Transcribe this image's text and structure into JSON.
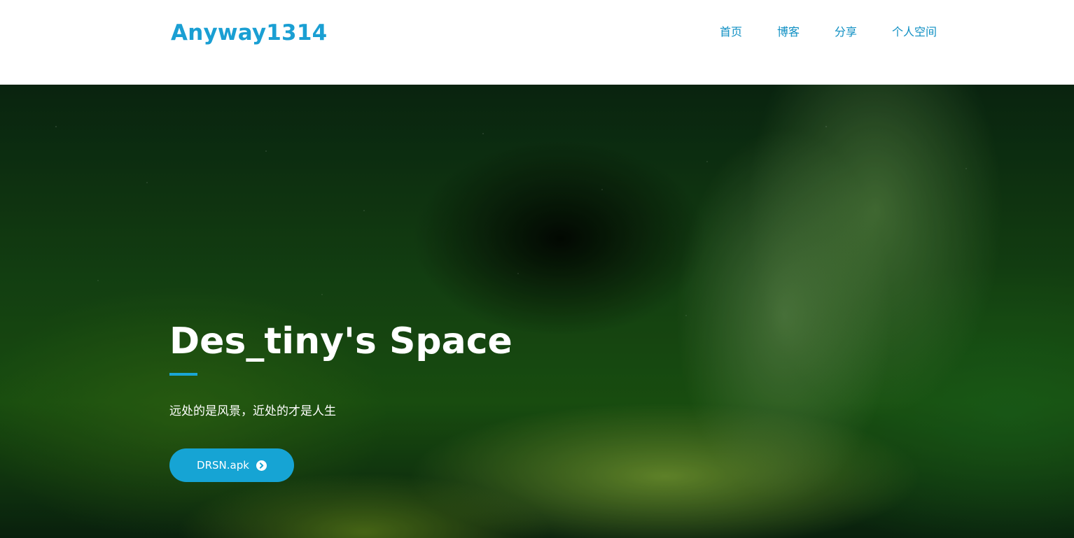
{
  "header": {
    "logo": "Anyway1314",
    "nav": [
      {
        "label": "首页"
      },
      {
        "label": "博客"
      },
      {
        "label": "分享"
      },
      {
        "label": "个人空间"
      }
    ]
  },
  "hero": {
    "title": "Des_tiny's Space",
    "subtitle": "远处的是风景，近处的才是人生",
    "button": {
      "label": "DRSN.apk",
      "icon": "chevron-circle-right-icon"
    }
  },
  "colors": {
    "accent": "#16a4d4",
    "logo": "#1a9fd3",
    "nav": "#0e8fc3"
  }
}
